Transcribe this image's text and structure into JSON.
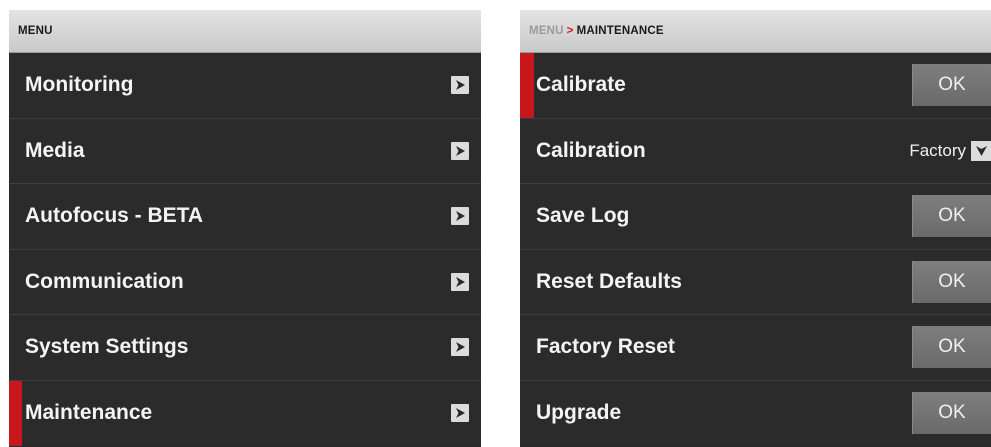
{
  "left_panel": {
    "header": {
      "title": "MENU"
    },
    "items": [
      {
        "label": "Monitoring",
        "selected": false
      },
      {
        "label": "Media",
        "selected": false
      },
      {
        "label": "Autofocus - BETA",
        "selected": false
      },
      {
        "label": "Communication",
        "selected": false
      },
      {
        "label": "System Settings",
        "selected": false
      },
      {
        "label": "Maintenance",
        "selected": true
      }
    ]
  },
  "right_panel": {
    "header": {
      "root": "MENU",
      "separator": ">",
      "current": "MAINTENANCE"
    },
    "items": [
      {
        "label": "Calibrate",
        "control": "button",
        "button_label": "OK",
        "selected": true
      },
      {
        "label": "Calibration",
        "control": "dropdown",
        "value": "Factory",
        "selected": false
      },
      {
        "label": "Save Log",
        "control": "button",
        "button_label": "OK",
        "selected": false
      },
      {
        "label": "Reset Defaults",
        "control": "button",
        "button_label": "OK",
        "selected": false
      },
      {
        "label": "Factory Reset",
        "control": "button",
        "button_label": "OK",
        "selected": false
      },
      {
        "label": "Upgrade",
        "control": "button",
        "button_label": "OK",
        "selected": false
      }
    ]
  },
  "icons": {
    "submenu": "chevron-right-icon",
    "dropdown": "triangle-down-icon"
  },
  "colors": {
    "selection_accent": "#c8161d",
    "panel_background": "#2b2b2b",
    "header_background": "#d6d6d6",
    "button_background": "#747474"
  }
}
